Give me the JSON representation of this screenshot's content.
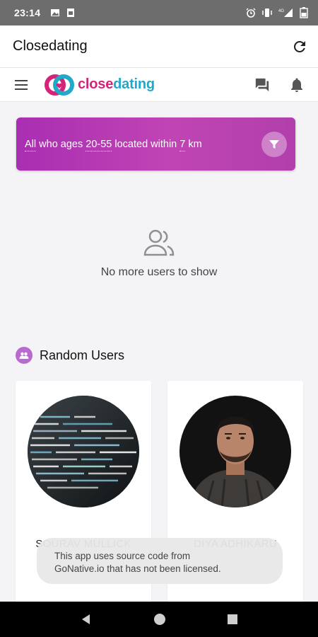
{
  "status_bar": {
    "time": "23:14",
    "left_icons": [
      "image-icon",
      "sim-card-icon"
    ],
    "right_icons": [
      "alarm-icon",
      "vibrate-icon",
      "signal-icon",
      "battery-icon"
    ],
    "network": "4G"
  },
  "app_bar": {
    "title": "Closedating",
    "action_icon": "refresh-icon"
  },
  "nav": {
    "menu_icon": "hamburger-menu-icon",
    "logo_part1": "close",
    "logo_part2": "dating",
    "icons": [
      "chat-icon",
      "bell-icon"
    ],
    "brand_colors": {
      "pink": "#d6237a",
      "blue": "#20a9c8"
    }
  },
  "filter": {
    "prefix": "All",
    "who_ages": " who ages ",
    "age_range": "20-55",
    "located_within": " located within ",
    "distance": "7",
    "unit": " km",
    "gradient_color": "#b13fb0",
    "button_icon": "filter-funnel-icon"
  },
  "empty_state": {
    "icon": "people-icon",
    "text": "No more users to show"
  },
  "random_users": {
    "title": "Random Users",
    "icon": "users-badge-icon",
    "users": [
      {
        "name": "SOURAV MULLICK"
      },
      {
        "name": "DIYA ADHIKARU"
      }
    ]
  },
  "toast": {
    "line1": "This app uses source code from",
    "line2": "GoNative.io that has not been licensed."
  },
  "system_nav": {
    "icons": [
      "back-icon",
      "home-icon",
      "recents-icon"
    ]
  }
}
